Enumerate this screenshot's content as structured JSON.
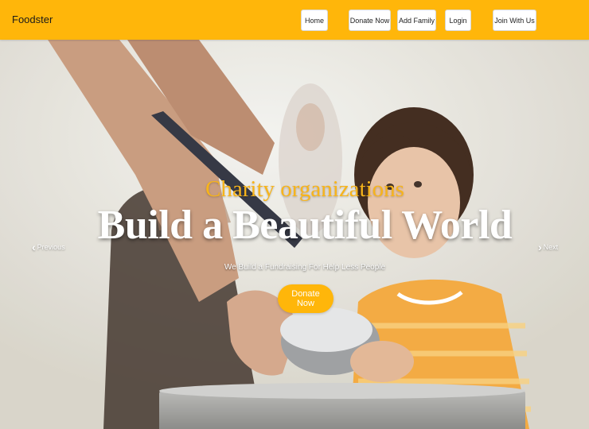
{
  "brand": "Foodster",
  "nav": {
    "home": "Home",
    "donate": "Donate Now",
    "add_family": "Add Family",
    "login": "Login",
    "join": "Join With Us"
  },
  "hero": {
    "subtitle": "Charity organizations",
    "headline": "Build a Beautiful World",
    "tagline": "We Build a Fundraising For Help Less People",
    "cta": "Donate Now",
    "prev": "Previous",
    "next": "Next"
  },
  "icons": [
    "chevron-left-icon",
    "chevron-right-icon"
  ],
  "colors": {
    "accent": "#ffb60a",
    "subtitle": "#f7b41b",
    "headline": "#ffffff"
  }
}
